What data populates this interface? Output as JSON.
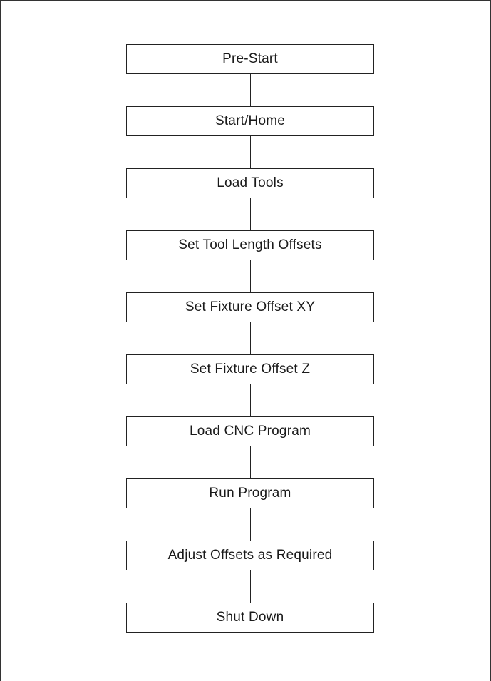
{
  "flowchart": {
    "steps": [
      "Pre-Start",
      "Start/Home",
      "Load Tools",
      "Set Tool Length Offsets",
      "Set Fixture Offset XY",
      "Set Fixture Offset Z",
      "Load CNC Program",
      "Run Program",
      "Adjust Offsets as Required",
      "Shut Down"
    ]
  }
}
